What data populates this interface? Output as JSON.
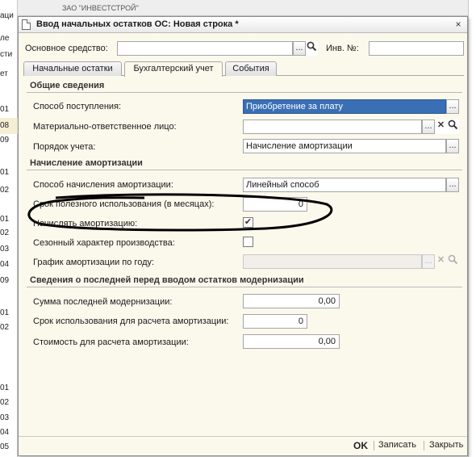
{
  "background": {
    "top_text": "ЗАО \"ИНВЕСТСТРОЙ\"",
    "left_fragments": [
      "аци",
      "ле",
      "сти",
      "ет",
      "01",
      "08",
      "09",
      "01",
      "02",
      "01",
      "02",
      "03",
      "04",
      "09",
      "01",
      "02",
      "01",
      "02",
      "03",
      "04",
      "05"
    ]
  },
  "window": {
    "title": "Ввод начальных остатков ОС: Новая строка *",
    "close": "×"
  },
  "header": {
    "asset_label": "Основное средство:",
    "asset_value": "",
    "inv_label": "Инв. №:",
    "inv_value": ""
  },
  "tabs": [
    {
      "label": "Начальные остатки"
    },
    {
      "label": "Бухгалтерский учет"
    },
    {
      "label": "События"
    }
  ],
  "sections": {
    "general": "Общие сведения",
    "depreciation": "Начисление амортизации",
    "modernization": "Сведения о последней перед вводом остатков модернизации"
  },
  "general": {
    "receipt_label": "Способ поступления:",
    "receipt_value": "Приобретение за плату",
    "responsible_label": "Материально-ответственное лицо:",
    "responsible_value": "",
    "accounting_label": "Порядок учета:",
    "accounting_value": "Начисление амортизации"
  },
  "depreciation": {
    "method_label": "Способ начисления амортизации:",
    "method_value": "Линейный способ",
    "useful_life_label": "Срок полезного использования (в месяцах):",
    "useful_life_value": "0",
    "charge_label": "Начислять амортизацию:",
    "charge_checked": true,
    "seasonal_label": "Сезонный характер производства:",
    "seasonal_checked": false,
    "schedule_label": "График амортизации по году:",
    "schedule_value": ""
  },
  "modernization": {
    "sum_label": "Сумма последней модернизации:",
    "sum_value": "0,00",
    "period_label": "Срок использования для расчета амортизации:",
    "period_value": "0",
    "cost_label": "Стоимость для расчета амортизации:",
    "cost_value": "0,00"
  },
  "footer": {
    "ok": "OK",
    "save": "Записать",
    "close": "Закрыть"
  },
  "glyphs": {
    "ellipsis": "...",
    "clear": "✕",
    "check": "✔"
  }
}
